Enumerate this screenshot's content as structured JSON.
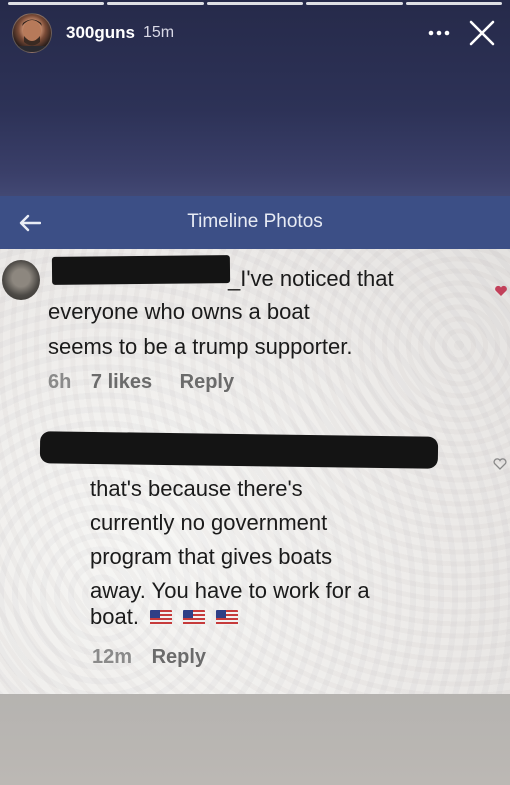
{
  "story": {
    "username": "300guns",
    "time": "15m",
    "segments": 5
  },
  "screenshot": {
    "title": "Timeline Photos",
    "comments": [
      {
        "text_line1": "_I've noticed that",
        "text_line2": "everyone who owns a boat",
        "text_line3": "seems to be a trump supporter.",
        "time": "6h",
        "likes": "7 likes",
        "reply": "Reply"
      },
      {
        "text_line1": "that's because there's",
        "text_line2": "currently no government",
        "text_line3": "program that gives boats",
        "text_line4": "away. You have to work for a",
        "text_line5": "boat.",
        "time": "12m",
        "reply": "Reply"
      }
    ]
  },
  "colors": {
    "fb_blue": "#3c4f86",
    "heart_red": "#c2405a"
  },
  "icons": [
    "more-icon",
    "close-icon",
    "back-arrow-icon",
    "heart-icon",
    "us-flag-icon"
  ]
}
